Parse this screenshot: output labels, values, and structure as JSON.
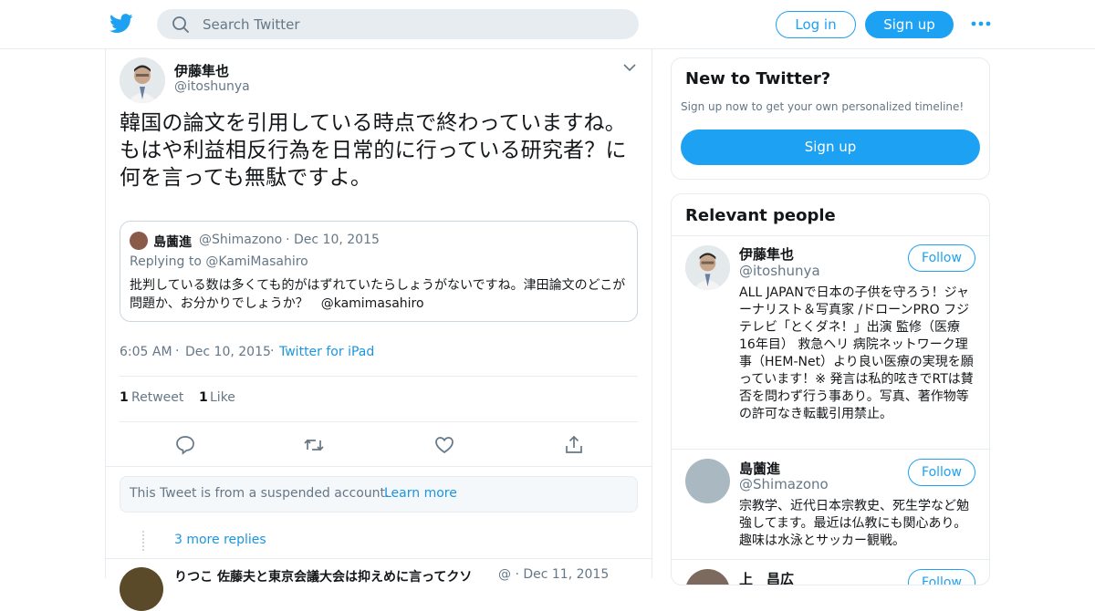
{
  "nav": {
    "search_placeholder": "Search Twitter",
    "login_label": "Log in",
    "signup_label": "Sign up",
    "brand_color": "#1da1f2"
  },
  "tweet": {
    "author_name": "伊藤隼也",
    "author_handle": "@itoshunya",
    "text": "韓国の論文を引用している時点で終わっていますね。もはや利益相反行為を日常的に行っている研究者？に何を言っても無駄ですよ。",
    "quoted": {
      "name": "島薗進",
      "handle": "@Shimazono",
      "dot": "·",
      "date": "Dec 10, 2015",
      "replying_to": "Replying to @KamiMasahiro",
      "text": "批判している数は多くても的がはずれていたらしょうがないですね。津田論文のどこが問題か、お分かりでしょうか？　@kamimasahiro"
    },
    "time": "6:05 AM",
    "dot": "·",
    "date": "Dec 10, 2015",
    "source": "Twitter for iPad",
    "retweet_count": "1",
    "retweet_label": "Retweet",
    "like_count": "1",
    "like_label": "Like",
    "actions": [
      "reply-icon",
      "retweet-icon",
      "like-icon",
      "share-icon"
    ]
  },
  "suspended_notice": {
    "text": "This Tweet is from a suspended account.",
    "link": "Learn more"
  },
  "more_replies": "3 more replies",
  "next_reply": {
    "line": "りつこ 佐藤夫と東京会議大会は抑えめに言ってクソ",
    "meta": "@ · Dec 11, 2015"
  },
  "sidebar": {
    "new_title": "New to Twitter?",
    "new_sub": "Sign up now to get your own personalized timeline!",
    "new_signup": "Sign up",
    "relevant_title": "Relevant people",
    "people": [
      {
        "name": "伊藤隼也",
        "handle": "@itoshunya",
        "follow": "Follow",
        "bio": "ALL JAPANで日本の子供を守ろう！ジャーナリスト＆写真家 /ドローンPRO フジテレビ「とくダネ！」出演 監修（医療 16年目） 救急ヘリ 病院ネットワーク理事（HEM-Net）より良い医療の実現を願っています！※ 発言は私的呟きでRTは賛否を問わず行う事あり。写真、著作物等の許可なき転載引用禁止。"
      },
      {
        "name": "島薗進",
        "handle": "@Shimazono",
        "follow": "Follow",
        "bio": "宗教学、近代日本宗教史、死生学など勉強してます。最近は仏教にも関心あり。趣味は水泳とサッカー観戦。"
      },
      {
        "name": "上　昌広",
        "handle": "",
        "follow": "Follow",
        "bio": ""
      }
    ]
  }
}
